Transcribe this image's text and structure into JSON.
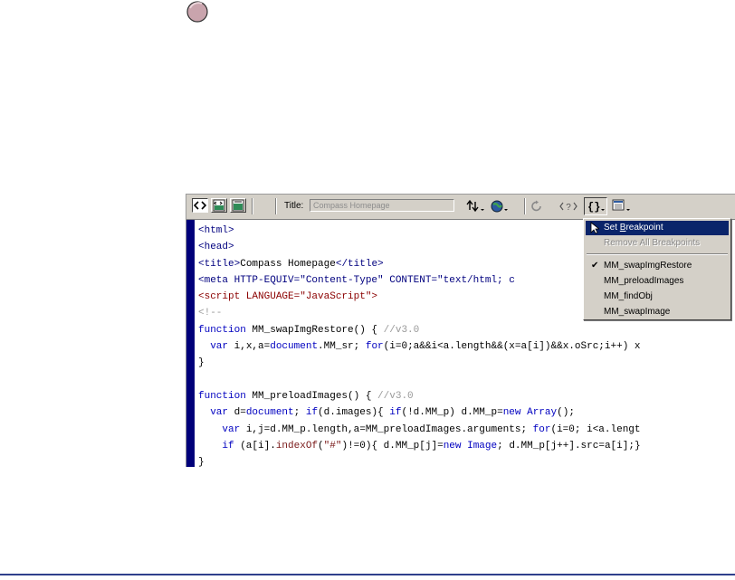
{
  "editor": {
    "title_label": "Title:",
    "title_value": "Compass Homepage"
  },
  "code_lines": [
    [
      {
        "c": "c-tag",
        "t": "<html>"
      }
    ],
    [
      {
        "c": "c-tag",
        "t": "<head>"
      }
    ],
    [
      {
        "c": "c-tag",
        "t": "<title>"
      },
      {
        "c": "c-text",
        "t": "Compass Homepage"
      },
      {
        "c": "c-tag",
        "t": "</title>"
      }
    ],
    [
      {
        "c": "c-tag",
        "t": "<meta HTTP-EQUIV=\"Content-Type\" CONTENT=\"text/html; c"
      }
    ],
    [
      {
        "c": "c-script",
        "t": "<script LANGUAGE=\"JavaScript\">"
      }
    ],
    [
      {
        "c": "c-comment",
        "t": "<!--"
      }
    ],
    [
      {
        "c": "c-kw",
        "t": "function"
      },
      {
        "c": "c-plain",
        "t": " MM_swapImgRestore() { "
      },
      {
        "c": "c-comment",
        "t": "//v3.0"
      }
    ],
    [
      {
        "c": "c-plain",
        "t": "  "
      },
      {
        "c": "c-kw",
        "t": "var"
      },
      {
        "c": "c-plain",
        "t": " i,x,a="
      },
      {
        "c": "c-kw",
        "t": "document"
      },
      {
        "c": "c-plain",
        "t": ".MM_sr; "
      },
      {
        "c": "c-kw",
        "t": "for"
      },
      {
        "c": "c-plain",
        "t": "(i=0;a&&i<a.length&&(x=a[i])&&x.oSrc;i++) x"
      }
    ],
    [
      {
        "c": "c-plain",
        "t": "}"
      }
    ],
    [
      {
        "c": "c-plain",
        "t": ""
      }
    ],
    [
      {
        "c": "c-kw",
        "t": "function"
      },
      {
        "c": "c-plain",
        "t": " MM_preloadImages() { "
      },
      {
        "c": "c-comment",
        "t": "//v3.0"
      }
    ],
    [
      {
        "c": "c-plain",
        "t": "  "
      },
      {
        "c": "c-kw",
        "t": "var"
      },
      {
        "c": "c-plain",
        "t": " d="
      },
      {
        "c": "c-kw",
        "t": "document"
      },
      {
        "c": "c-plain",
        "t": "; "
      },
      {
        "c": "c-kw",
        "t": "if"
      },
      {
        "c": "c-plain",
        "t": "(d.images){ "
      },
      {
        "c": "c-kw",
        "t": "if"
      },
      {
        "c": "c-plain",
        "t": "(!d.MM_p) d.MM_p="
      },
      {
        "c": "c-kw",
        "t": "new"
      },
      {
        "c": "c-plain",
        "t": " "
      },
      {
        "c": "c-kw",
        "t": "Array"
      },
      {
        "c": "c-plain",
        "t": "();"
      }
    ],
    [
      {
        "c": "c-plain",
        "t": "    "
      },
      {
        "c": "c-kw",
        "t": "var"
      },
      {
        "c": "c-plain",
        "t": " i,j=d.MM_p.length,a=MM_preloadImages.arguments; "
      },
      {
        "c": "c-kw",
        "t": "for"
      },
      {
        "c": "c-plain",
        "t": "(i=0; i<a.lengt"
      }
    ],
    [
      {
        "c": "c-plain",
        "t": "    "
      },
      {
        "c": "c-kw",
        "t": "if"
      },
      {
        "c": "c-plain",
        "t": " (a[i]."
      },
      {
        "c": "c-str",
        "t": "indexOf"
      },
      {
        "c": "c-plain",
        "t": "("
      },
      {
        "c": "c-str",
        "t": "\"#\""
      },
      {
        "c": "c-plain",
        "t": ")!=0){ d.MM_p[j]="
      },
      {
        "c": "c-kw",
        "t": "new"
      },
      {
        "c": "c-plain",
        "t": " "
      },
      {
        "c": "c-kw",
        "t": "Image"
      },
      {
        "c": "c-plain",
        "t": "; d.MM_p[j++].src=a[i];}"
      }
    ],
    [
      {
        "c": "c-plain",
        "t": "}"
      }
    ]
  ],
  "menu": {
    "set_breakpoint_pre": "Set ",
    "set_breakpoint_u": "B",
    "set_breakpoint_post": "reakpoint",
    "remove_all": "Remove All Breakpoints",
    "functions": [
      "MM_swapImgRestore",
      "MM_preloadImages",
      "MM_findObj",
      "MM_swapImage"
    ],
    "checked_function": "MM_swapImgRestore",
    "check_mark": "✔"
  },
  "icons": {
    "record": "record-button-icon",
    "code_view": "code-view-icon",
    "split_view": "code-and-design-view-icon",
    "design_view": "design-view-icon",
    "file_management": "file-management-icon",
    "preview": "preview-in-browser-icon",
    "refresh": "refresh-icon",
    "reference": "reference-icon",
    "debug": "code-navigation-icon",
    "view_options": "view-options-icon"
  },
  "colors": {
    "gutter": "#00007a",
    "menu_highlight": "#0a246a",
    "tag": "#00007f",
    "keyword": "#0000c0",
    "comment": "#9a9a9a"
  }
}
